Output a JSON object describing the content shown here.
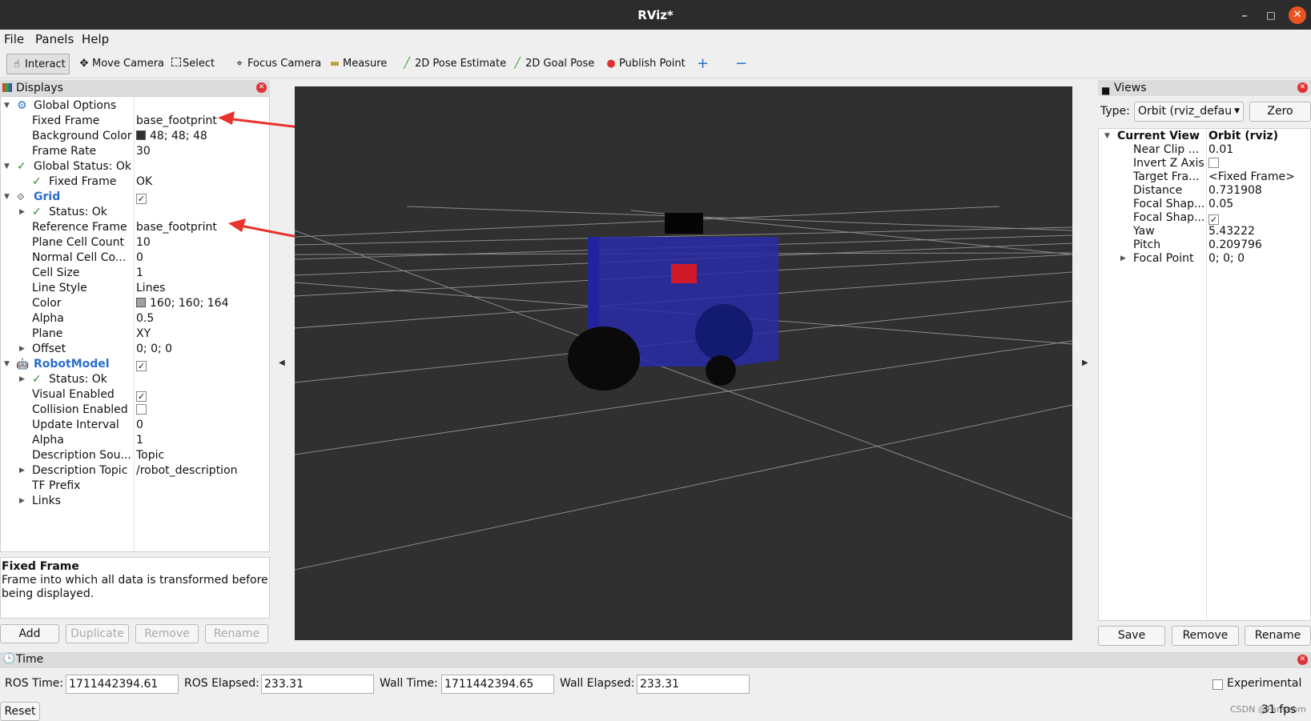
{
  "window": {
    "title": "RViz*"
  },
  "menu": [
    "File",
    "Panels",
    "Help"
  ],
  "toolbar": {
    "interact": "Interact",
    "move_camera": "Move Camera",
    "select": "Select",
    "focus_camera": "Focus Camera",
    "measure": "Measure",
    "pose_estimate": "2D Pose Estimate",
    "goal_pose": "2D Goal Pose",
    "publish_point": "Publish Point"
  },
  "displays": {
    "title": "Displays",
    "rows": [
      {
        "name": "Global Options",
        "value": ""
      },
      {
        "name": "Fixed Frame",
        "value": "base_footprint"
      },
      {
        "name": "Background Color",
        "value": "48; 48; 48"
      },
      {
        "name": "Frame Rate",
        "value": "30"
      },
      {
        "name": "Global Status: Ok",
        "value": ""
      },
      {
        "name": "Fixed Frame",
        "value": "OK"
      },
      {
        "name": "Grid",
        "value": ""
      },
      {
        "name": "Status: Ok",
        "value": ""
      },
      {
        "name": "Reference Frame",
        "value": "base_footprint"
      },
      {
        "name": "Plane Cell Count",
        "value": "10"
      },
      {
        "name": "Normal Cell Co...",
        "value": "0"
      },
      {
        "name": "Cell Size",
        "value": "1"
      },
      {
        "name": "Line Style",
        "value": "Lines"
      },
      {
        "name": "Color",
        "value": "160; 160; 164"
      },
      {
        "name": "Alpha",
        "value": "0.5"
      },
      {
        "name": "Plane",
        "value": "XY"
      },
      {
        "name": "Offset",
        "value": "0; 0; 0"
      },
      {
        "name": "RobotModel",
        "value": ""
      },
      {
        "name": "Status: Ok",
        "value": ""
      },
      {
        "name": "Visual Enabled",
        "value": ""
      },
      {
        "name": "Collision Enabled",
        "value": ""
      },
      {
        "name": "Update Interval",
        "value": "0"
      },
      {
        "name": "Alpha",
        "value": "1"
      },
      {
        "name": "Description Sou...",
        "value": "Topic"
      },
      {
        "name": "Description Topic",
        "value": "/robot_description"
      },
      {
        "name": "TF Prefix",
        "value": ""
      },
      {
        "name": "Links",
        "value": ""
      }
    ],
    "description_title": "Fixed Frame",
    "description_text": "Frame into which all data is transformed before being displayed.",
    "buttons": {
      "add": "Add",
      "duplicate": "Duplicate",
      "remove": "Remove",
      "rename": "Rename"
    }
  },
  "views": {
    "title": "Views",
    "type_label": "Type:",
    "type_value": "Orbit (rviz_defau",
    "zero": "Zero",
    "header_name": "Current View",
    "header_value": "Orbit (rviz)",
    "rows": [
      {
        "name": "Near Clip ...",
        "value": "0.01"
      },
      {
        "name": "Invert Z Axis",
        "value": ""
      },
      {
        "name": "Target Fra...",
        "value": "<Fixed Frame>"
      },
      {
        "name": "Distance",
        "value": "0.731908"
      },
      {
        "name": "Focal Shap...",
        "value": "0.05"
      },
      {
        "name": "Focal Shap...",
        "value": ""
      },
      {
        "name": "Yaw",
        "value": "5.43222"
      },
      {
        "name": "Pitch",
        "value": "0.209796"
      },
      {
        "name": "Focal Point",
        "value": "0; 0; 0"
      }
    ],
    "buttons": {
      "save": "Save",
      "remove": "Remove",
      "rename": "Rename"
    }
  },
  "time": {
    "title": "Time",
    "ros_time_label": "ROS Time:",
    "ros_time": "1711442394.61",
    "ros_elapsed_label": "ROS Elapsed:",
    "ros_elapsed": "233.31",
    "wall_time_label": "Wall Time:",
    "wall_time": "1711442394.65",
    "wall_elapsed_label": "Wall Elapsed:",
    "wall_elapsed": "233.31",
    "experimental": "Experimental",
    "reset": "Reset",
    "fps": "31 fps",
    "watermark": "CSDN @Fanseom"
  },
  "colors": {
    "viewport_bg": "#303030",
    "robot_body": "#2a2aa8",
    "arrow": "#e8322a"
  }
}
